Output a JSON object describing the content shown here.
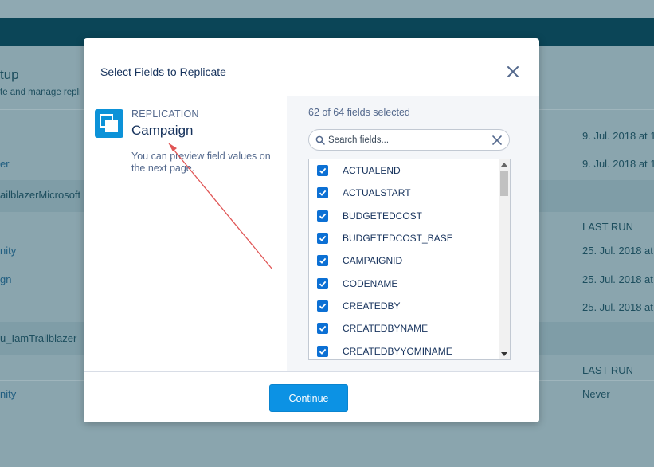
{
  "background": {
    "title_fragment": "tup",
    "subtitle_fragment": "te and manage repli",
    "left_rows": [
      {
        "text": "er",
        "link": true
      },
      {
        "text": "ailblazerMicrosoft",
        "link": false
      },
      {
        "text": "nity",
        "link": true
      },
      {
        "text": "gn",
        "link": true
      },
      {
        "text": "u_IamTrailblazer",
        "link": false
      },
      {
        "text": "nity",
        "link": true
      }
    ],
    "right_rows": [
      {
        "text": "9. Jul. 2018 at 1"
      },
      {
        "text": "9. Jul. 2018 at 1"
      },
      {
        "text": "LAST RUN"
      },
      {
        "text": "25. Jul. 2018 at"
      },
      {
        "text": "25. Jul. 2018 at"
      },
      {
        "text": "25. Jul. 2018 at"
      },
      {
        "text": "LAST RUN"
      },
      {
        "text": "Never"
      }
    ]
  },
  "modal": {
    "title": "Select Fields to Replicate",
    "replication_label": "REPLICATION",
    "object_name": "Campaign",
    "hint": "You can preview field values on the next page.",
    "fields_count_text": "62 of 64 fields selected",
    "search_placeholder": "Search fields...",
    "fields": [
      {
        "name": "ACTUALEND",
        "checked": true
      },
      {
        "name": "ACTUALSTART",
        "checked": true
      },
      {
        "name": "BUDGETEDCOST",
        "checked": true
      },
      {
        "name": "BUDGETEDCOST_BASE",
        "checked": true
      },
      {
        "name": "CAMPAIGNID",
        "checked": true
      },
      {
        "name": "CODENAME",
        "checked": true
      },
      {
        "name": "CREATEDBY",
        "checked": true
      },
      {
        "name": "CREATEDBYNAME",
        "checked": true
      },
      {
        "name": "CREATEDBYYOMINAME",
        "checked": true
      }
    ],
    "continue_label": "Continue"
  },
  "colors": {
    "header_bar": "#0b4557",
    "accent": "#0c92e4",
    "checkbox": "#0c70d4",
    "annotation_arrow": "#e05555"
  },
  "icons": {
    "close": "close-icon",
    "search": "search-icon",
    "clear": "clear-icon",
    "replication": "replication-icon",
    "checkbox": "checkmark-icon"
  }
}
